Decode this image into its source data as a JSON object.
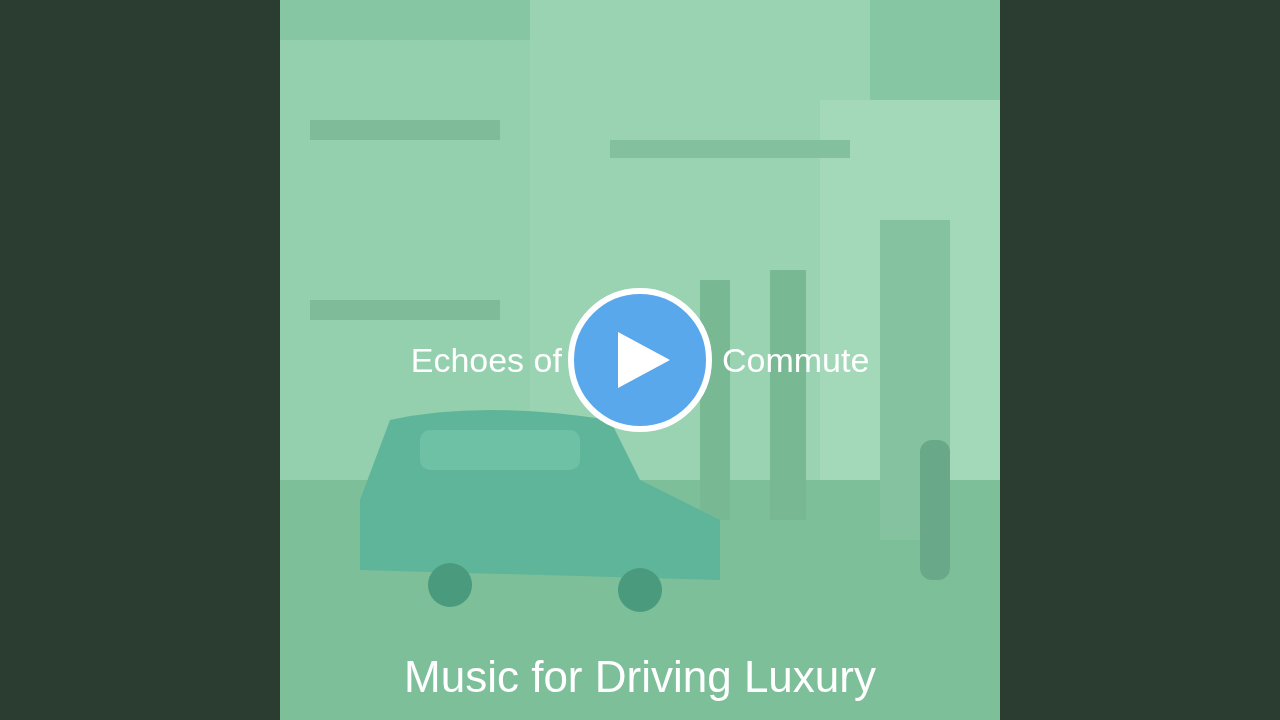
{
  "video": {
    "kind": "picture",
    "title_parts": [
      "Echoes of",
      "Commute"
    ],
    "caption": "Music for Driving Luxury"
  }
}
